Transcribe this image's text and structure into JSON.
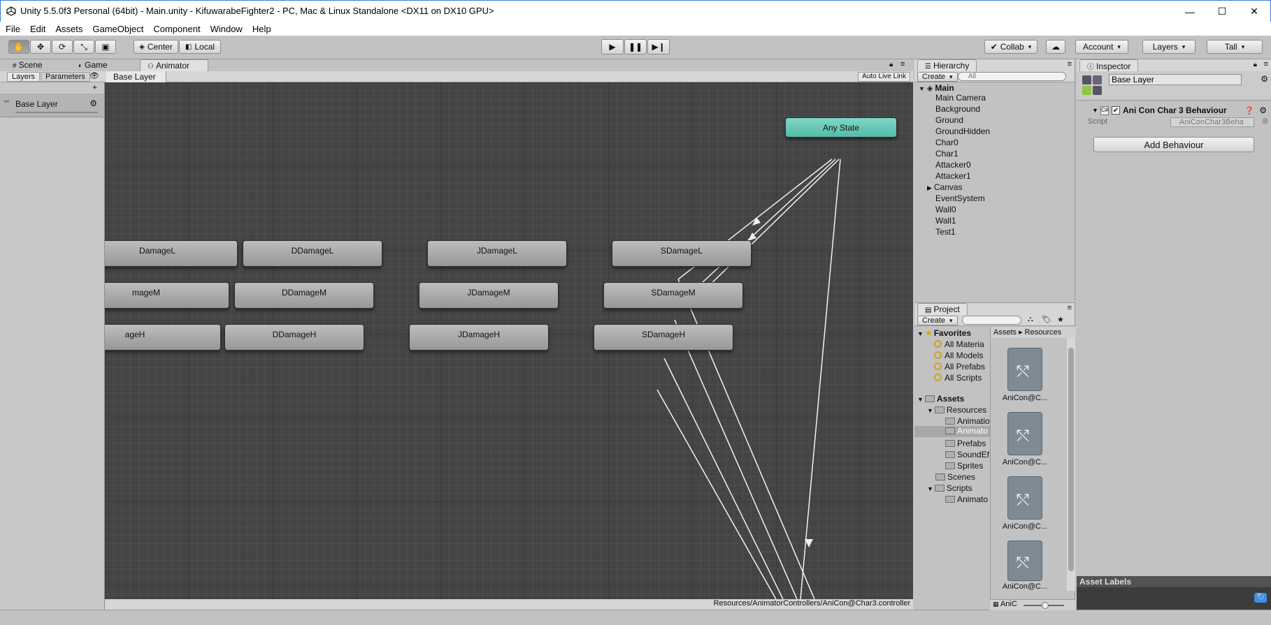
{
  "window": {
    "title": "Unity 5.5.0f3 Personal (64bit) - Main.unity - KifuwarabeFighter2 - PC, Mac & Linux Standalone <DX11 on DX10 GPU>"
  },
  "menu": [
    "File",
    "Edit",
    "Assets",
    "GameObject",
    "Component",
    "Window",
    "Help"
  ],
  "toolbar": {
    "pivot": "Center",
    "space": "Local",
    "collab": "Collab",
    "account": "Account",
    "layers": "Layers",
    "layout": "Tall"
  },
  "tabs": {
    "scene": "Scene",
    "game": "Game",
    "animator": "Animator"
  },
  "animator": {
    "layers_tab": "Layers",
    "parameters_tab": "Parameters",
    "breadcrumb": "Base Layer",
    "auto_live_link": "Auto Live Link",
    "layer_item": "Base Layer",
    "status_path": "Resources/AnimatorControllers/AniCon@Char3.controller",
    "any_state": "Any State",
    "states": [
      "DamageL",
      "DDamageL",
      "JDamageL",
      "SDamageL",
      "mageM",
      "DDamageM",
      "JDamageM",
      "SDamageM",
      "ageH",
      "DDamageH",
      "JDamageH",
      "SDamageH"
    ]
  },
  "hierarchy": {
    "title": "Hierarchy",
    "create": "Create",
    "search_placeholder": "All",
    "scene": "Main",
    "items": [
      "Main Camera",
      "Background",
      "Ground",
      "GroundHidden",
      "Char0",
      "Char1",
      "Attacker0",
      "Attacker1",
      "Canvas",
      "EventSystem",
      "Wall0",
      "Wall1",
      "Test1"
    ]
  },
  "project": {
    "title": "Project",
    "create": "Create",
    "favorites": "Favorites",
    "fav_items": [
      "All Materia",
      "All Models",
      "All Prefabs",
      "All Scripts"
    ],
    "assets": "Assets",
    "tree": [
      "Resources",
      "Animatio",
      "Animato",
      "Prefabs",
      "SoundEf",
      "Sprites",
      "Scenes",
      "Scripts",
      "Animato"
    ],
    "breadcrumb_assets": "Assets",
    "breadcrumb_resources": "Resources",
    "thumb_labels": [
      "AniCon@C...",
      "AniCon@C...",
      "AniCon@C...",
      "AniCon@C..."
    ],
    "footer_label": "AniC"
  },
  "inspector": {
    "title": "Inspector",
    "object_name": "Base Layer",
    "component": "Ani Con Char 3 Behaviour",
    "script_label": "Script",
    "script_value": "AniConChar3Beha",
    "add_behaviour": "Add Behaviour",
    "asset_labels": "Asset Labels"
  }
}
